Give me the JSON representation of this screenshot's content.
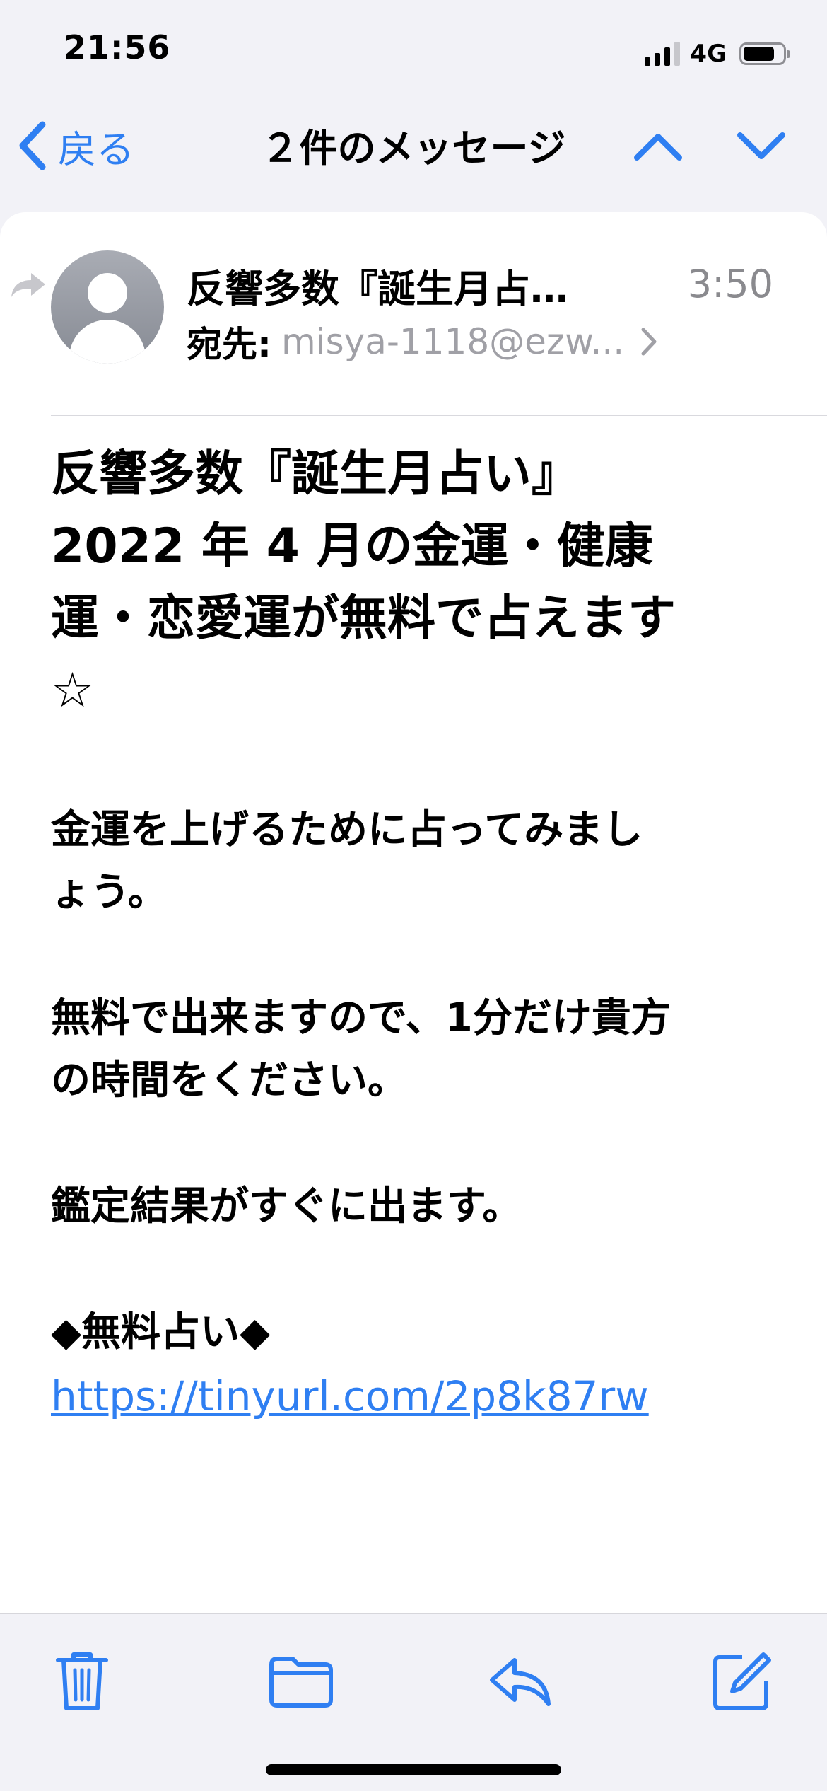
{
  "status_bar": {
    "time": "21:56",
    "network": "4G",
    "battery_level": 0.8,
    "signal_bars": 3
  },
  "nav": {
    "back_label": "戻る",
    "title": "２件のメッセージ",
    "icons": [
      "chevron-left-icon",
      "chevron-up-icon",
      "chevron-down-icon"
    ]
  },
  "message": {
    "sender": "反響多数『誕生月占…",
    "time": "3:50",
    "to_label": "宛先:",
    "to_address": "misya-1118@ezw...",
    "subject_lines": [
      "反響多数『誕生月占い』",
      "2022 年 4 月の金運・健康",
      "運・恋愛運が無料で占えます"
    ],
    "subject_star": "☆",
    "body": {
      "p1_line1": "金運を上げるために占ってみまし",
      "p1_line2": "ょう。",
      "p2_line1": "無料で出来ますので、1分だけ貴方",
      "p2_line2": "の時間をください。",
      "p3": "鑑定結果がすぐに出ます。",
      "p4": "◆無料占い◆",
      "link": "https://tinyurl.com/2p8k87rw"
    }
  },
  "toolbar": {
    "icons": [
      "trash-icon",
      "folder-icon",
      "reply-icon",
      "compose-icon"
    ]
  },
  "colors": {
    "accent": "#2f7ff2",
    "secondary_text": "#8a8a8e",
    "background": "#f2f2f7",
    "card": "#ffffff"
  }
}
